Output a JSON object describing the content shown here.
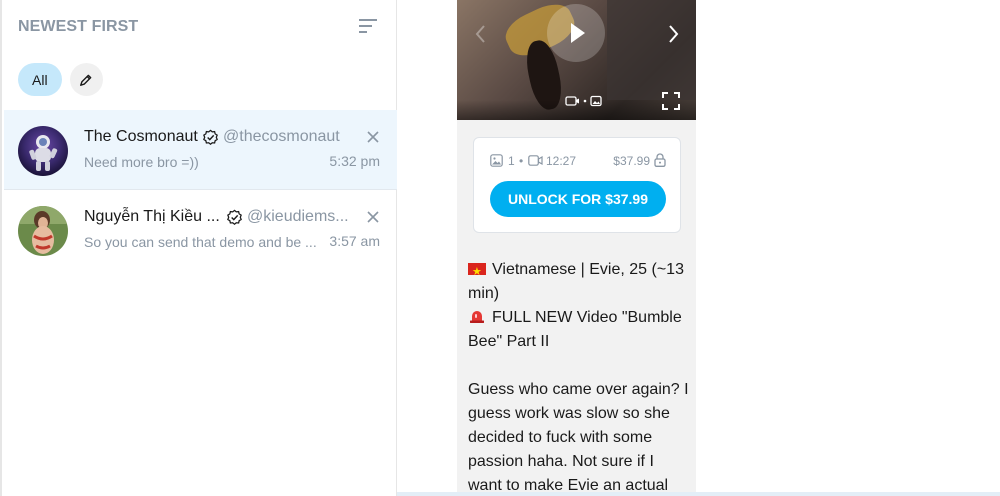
{
  "chat_list": {
    "title": "NEWEST FIRST",
    "sort_icon": "sort-lines-icon",
    "filters": {
      "all_label": "All",
      "edit_icon": "pencil-icon"
    },
    "chats": [
      {
        "name": "The Cosmonaut",
        "handle": "@thecosmonaut",
        "preview": "Need more bro =))",
        "time": "5:32 pm",
        "verified": true,
        "active": true
      },
      {
        "name": "Nguyễn Thị Kiều ...",
        "handle": "@kieudiems...",
        "preview": "So you can send that demo and be ...",
        "time": "3:57 am",
        "verified": true,
        "active": false
      }
    ]
  },
  "message": {
    "media": {
      "play_icon": "play-icon",
      "prev_icon": "chevron-left-icon",
      "next_icon": "chevron-right-icon",
      "fullscreen_icon": "fullscreen-icon"
    },
    "locked": {
      "image_count": "1",
      "separator": "•",
      "duration": "12:27",
      "price": "$37.99",
      "unlock_label": "UNLOCK FOR $37.99"
    },
    "caption": {
      "line1": "Vietnamese | Evie, 25 (~13 min)",
      "line2": "FULL NEW Video \"Bumble Bee\" Part II",
      "line3": "Guess who came over again? I guess work was slow so she decided to fuck with some passion haha. Not sure if I want to make Evie an actual"
    }
  },
  "colors": {
    "accent": "#00aff0",
    "active_row": "#edf6fd",
    "muted_text": "#8a96a3",
    "chip_bg": "#c5e8fb"
  }
}
